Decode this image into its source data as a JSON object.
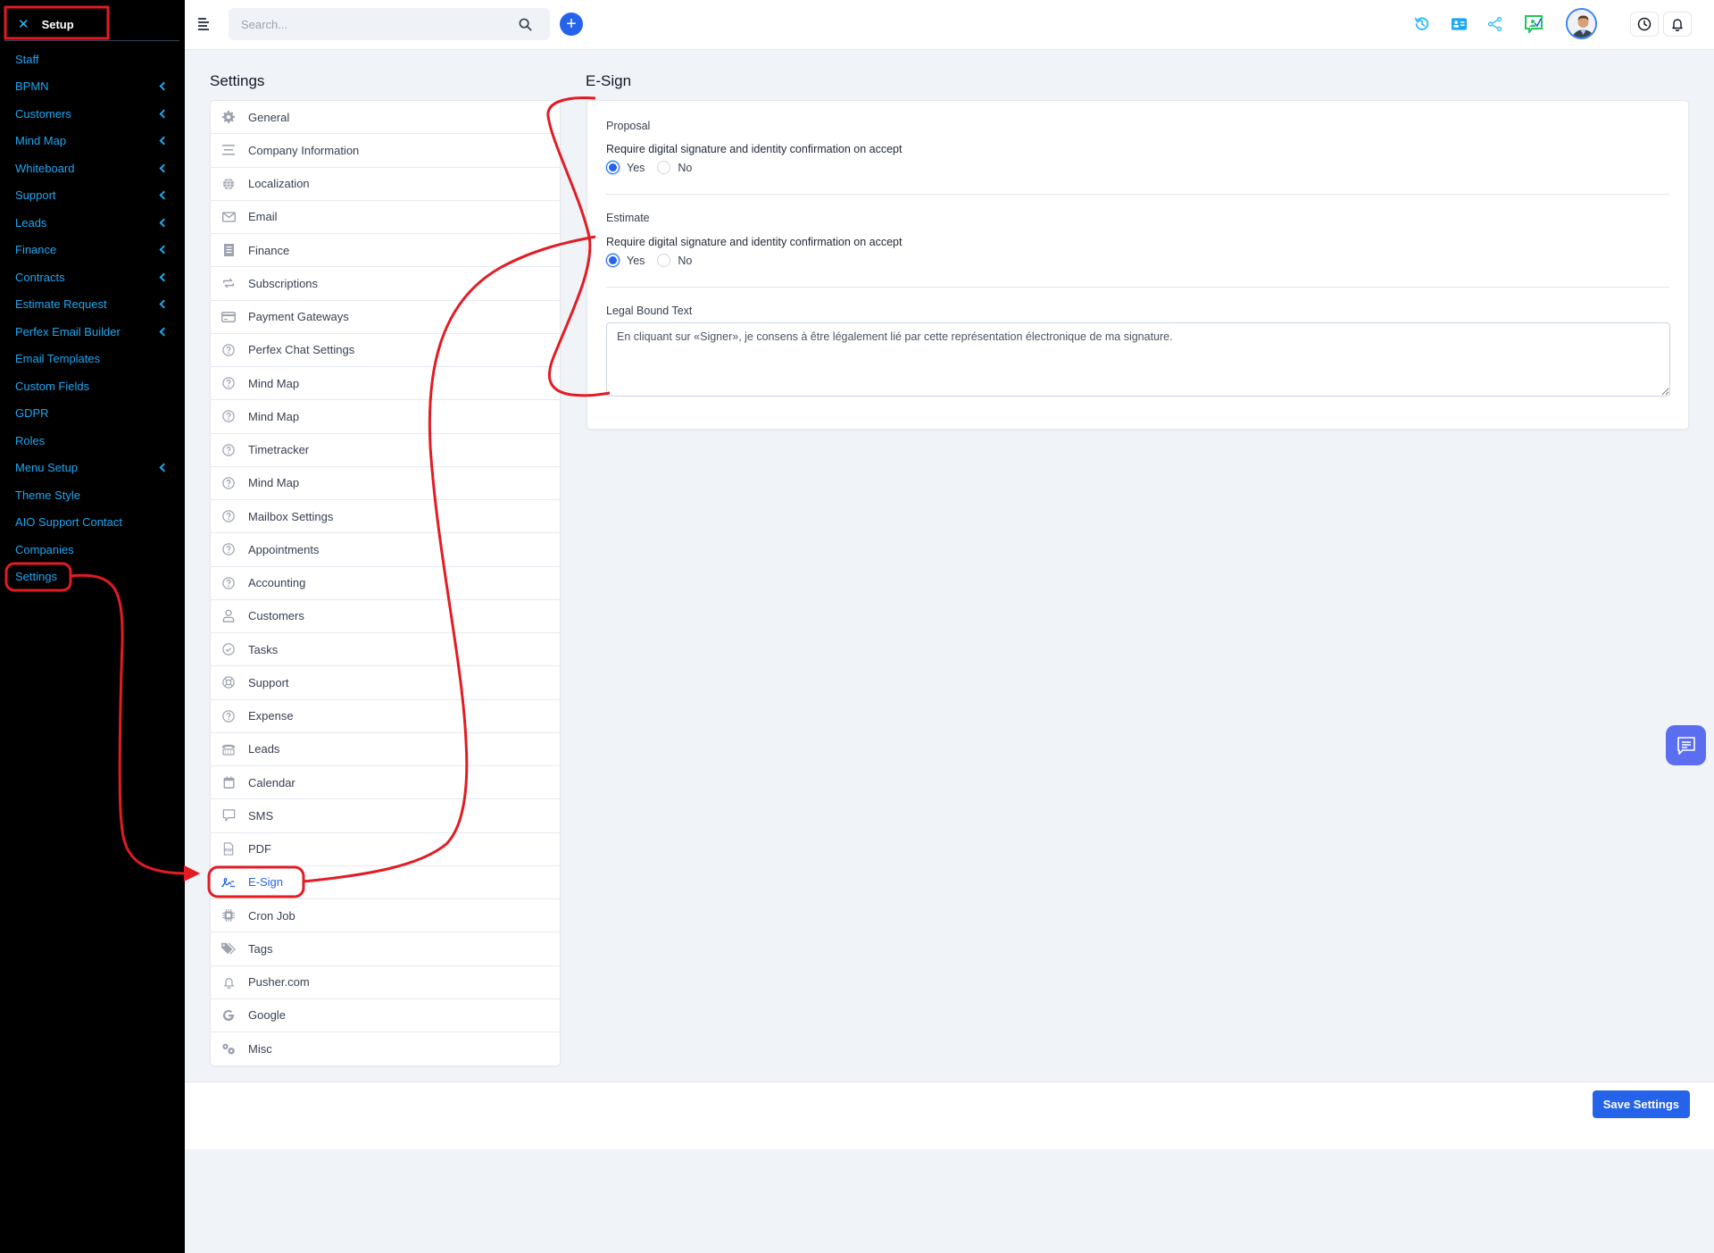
{
  "sidebar": {
    "header": {
      "close_icon": "close-icon",
      "title": "Setup"
    },
    "items": [
      {
        "label": "Staff",
        "has_submenu": false
      },
      {
        "label": "BPMN",
        "has_submenu": true
      },
      {
        "label": "Customers",
        "has_submenu": true
      },
      {
        "label": "Mind Map",
        "has_submenu": true
      },
      {
        "label": "Whiteboard",
        "has_submenu": true
      },
      {
        "label": "Support",
        "has_submenu": true
      },
      {
        "label": "Leads",
        "has_submenu": true
      },
      {
        "label": "Finance",
        "has_submenu": true
      },
      {
        "label": "Contracts",
        "has_submenu": true
      },
      {
        "label": "Estimate Request",
        "has_submenu": true
      },
      {
        "label": "Perfex Email Builder",
        "has_submenu": true
      },
      {
        "label": "Email Templates",
        "has_submenu": false
      },
      {
        "label": "Custom Fields",
        "has_submenu": false
      },
      {
        "label": "GDPR",
        "has_submenu": false
      },
      {
        "label": "Roles",
        "has_submenu": false
      },
      {
        "label": "Menu Setup",
        "has_submenu": true
      },
      {
        "label": "Theme Style",
        "has_submenu": false
      },
      {
        "label": "AIO Support Contact",
        "has_submenu": false
      },
      {
        "label": "Companies",
        "has_submenu": false
      },
      {
        "label": "Settings",
        "has_submenu": false,
        "highlighted": true
      }
    ],
    "text_color": "#1ea7f2"
  },
  "header": {
    "search": {
      "placeholder": "Search...",
      "value": ""
    },
    "icons": [
      "menu-icon",
      "search-icon",
      "plus-icon",
      "history-icon",
      "contact-card-icon",
      "share-icon",
      "chat-check-icon",
      "avatar",
      "clock-icon",
      "bell-icon"
    ]
  },
  "settings": {
    "title": "Settings",
    "items": [
      {
        "label": "General",
        "icon": "gear-icon"
      },
      {
        "label": "Company Information",
        "icon": "lines-icon"
      },
      {
        "label": "Localization",
        "icon": "globe-icon"
      },
      {
        "label": "Email",
        "icon": "envelope-icon"
      },
      {
        "label": "Finance",
        "icon": "receipt-icon"
      },
      {
        "label": "Subscriptions",
        "icon": "repeat-icon"
      },
      {
        "label": "Payment Gateways",
        "icon": "credit-card-icon"
      },
      {
        "label": "Perfex Chat Settings",
        "icon": "question-circle-icon"
      },
      {
        "label": "Mind Map",
        "icon": "question-circle-icon"
      },
      {
        "label": "Mind Map",
        "icon": "question-circle-icon"
      },
      {
        "label": "Timetracker",
        "icon": "question-circle-icon"
      },
      {
        "label": "Mind Map",
        "icon": "question-circle-icon"
      },
      {
        "label": "Mailbox Settings",
        "icon": "question-circle-icon"
      },
      {
        "label": "Appointments",
        "icon": "question-circle-icon"
      },
      {
        "label": "Accounting",
        "icon": "question-circle-icon"
      },
      {
        "label": "Customers",
        "icon": "user-icon"
      },
      {
        "label": "Tasks",
        "icon": "check-circle-icon"
      },
      {
        "label": "Support",
        "icon": "life-ring-icon"
      },
      {
        "label": "Expense",
        "icon": "question-circle-icon"
      },
      {
        "label": "Leads",
        "icon": "phone-icon"
      },
      {
        "label": "Calendar",
        "icon": "calendar-icon"
      },
      {
        "label": "SMS",
        "icon": "message-icon"
      },
      {
        "label": "PDF",
        "icon": "pdf-file-icon"
      },
      {
        "label": "E-Sign",
        "icon": "signature-icon",
        "active": true
      },
      {
        "label": "Cron Job",
        "icon": "chip-icon"
      },
      {
        "label": "Tags",
        "icon": "tags-icon"
      },
      {
        "label": "Pusher.com",
        "icon": "bell-icon"
      },
      {
        "label": "Google",
        "icon": "google-icon"
      },
      {
        "label": "Misc",
        "icon": "gears-icon"
      }
    ]
  },
  "esign": {
    "title": "E-Sign",
    "proposal": {
      "group_label": "Proposal",
      "question": "Require digital signature and identity confirmation on accept",
      "options": [
        "Yes",
        "No"
      ],
      "selected": "Yes"
    },
    "estimate": {
      "group_label": "Estimate",
      "question": "Require digital signature and identity confirmation on accept",
      "options": [
        "Yes",
        "No"
      ],
      "selected": "Yes"
    },
    "legal": {
      "label": "Legal Bound Text",
      "value": "En cliquant sur «Signer», je consens à être légalement lié par cette représentation électronique de ma signature."
    }
  },
  "footer": {
    "save_label": "Save Settings"
  },
  "colors": {
    "accent": "#2563eb",
    "sidebar_bg": "#000000",
    "page_bg": "#f0f3f8",
    "annotation": "#e31b23",
    "chat_fab": "#5b6ef0"
  }
}
